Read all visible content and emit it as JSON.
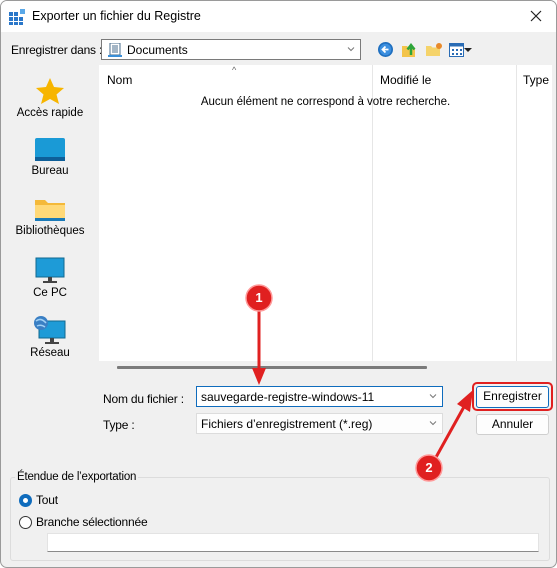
{
  "window": {
    "title": "Exporter un fichier du Registre",
    "icon": "registry-editor-icon",
    "close_icon": "close-icon"
  },
  "location": {
    "label": "Enregistrer dans :",
    "value": "Documents",
    "icon": "documents-icon",
    "toolbar_icons": [
      "back-icon",
      "up-folder-icon",
      "new-folder-icon",
      "view-menu-icon"
    ]
  },
  "places": [
    {
      "label": "Accès rapide",
      "icon": "star-icon"
    },
    {
      "label": "Bureau",
      "icon": "desktop-icon"
    },
    {
      "label": "Bibliothèques",
      "icon": "libraries-folder-icon"
    },
    {
      "label": "Ce PC",
      "icon": "monitor-icon"
    },
    {
      "label": "Réseau",
      "icon": "network-icon"
    }
  ],
  "list": {
    "columns": [
      "Nom",
      "Modifié le",
      "Type"
    ],
    "sort_indicator": "^",
    "empty_message": "Aucun élément ne correspond à votre recherche."
  },
  "form": {
    "filename_label": "Nom du fichier :",
    "filename_value": "sauvegarde-registre-windows-11",
    "type_label": "Type :",
    "type_value": "Fichiers d’enregistrement (*.reg)"
  },
  "buttons": {
    "save": "Enregistrer",
    "cancel": "Annuler"
  },
  "export_range": {
    "title": "Étendue de l’exportation",
    "options": [
      {
        "label": "Tout",
        "selected": true
      },
      {
        "label": "Branche sélectionnée",
        "selected": false
      }
    ],
    "branch_value": ""
  },
  "annotations": {
    "step1": "1",
    "step2": "2",
    "color": "#e02020"
  }
}
